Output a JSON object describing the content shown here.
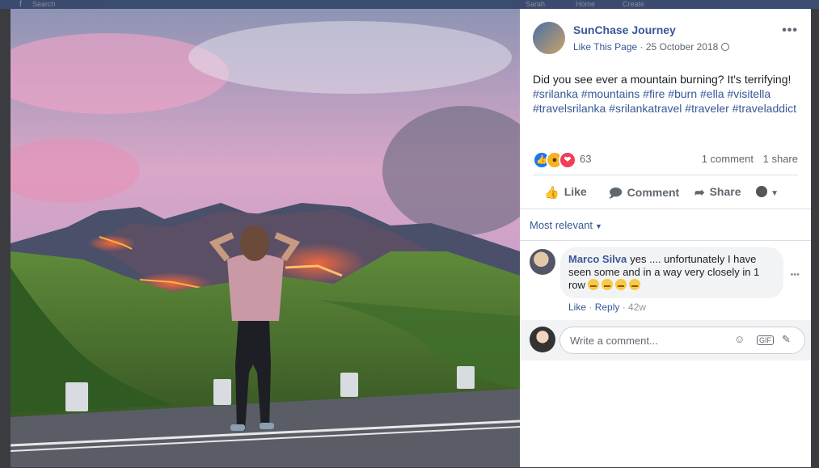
{
  "topbar": {
    "brand": "f",
    "search_placeholder": "Search",
    "tabs": [
      "Sarah",
      "Home",
      "Create"
    ]
  },
  "post": {
    "page_name": "SunChase Journey",
    "like_label": "Like This Page",
    "separator": " · ",
    "date": "25 October 2018",
    "text": "Did you see ever a mountain burning? It's terrifying!",
    "hashtags": "#srilanka #mountains #fire #burn #ella #visitella #travelsrilanka #srilankatravel #traveler #traveladdict",
    "more_icon": "•••"
  },
  "stats": {
    "reactions_count": "63",
    "comments": "1 comment",
    "shares": "1 share"
  },
  "actions": {
    "like": "Like",
    "comment": "Comment",
    "share": "Share"
  },
  "comments_filter": "Most relevant",
  "comment": {
    "author": "Marco Silva",
    "text": "yes .... unfortunately I have seen some and in a way very closely in 1 row",
    "like": "Like",
    "reply": "Reply",
    "age": "42w",
    "dot": " · "
  },
  "composer": {
    "placeholder": "Write a comment..."
  },
  "icons": {
    "more": "more-horizontal-icon",
    "globe": "globe-icon",
    "like": "thumbs-up-icon",
    "comment": "comment-bubble-icon",
    "share": "share-arrow-icon",
    "emoji": "emoji-icon",
    "gif": "gif-icon",
    "sticker": "sticker-icon"
  },
  "colors": {
    "link": "#385898",
    "text": "#1c1e21",
    "muted": "#606770",
    "like": "#1877f2",
    "love": "#f33e58",
    "wow": "#f7b125"
  }
}
